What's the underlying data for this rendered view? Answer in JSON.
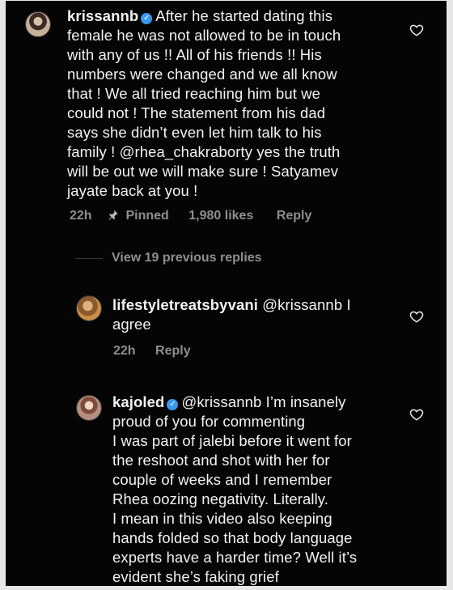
{
  "comments": [
    {
      "username": "krissannb",
      "text": "After he started dating this female he was not allowed to be in touch with any of us !! All of his friends !! His numbers were changed and we all know that ! We all tried reaching him but we could not ! The statement from his dad says she didn’t even let him talk to his family ! @rhea_chakraborty yes the truth will be out we will make sure ! Satyamev jayate back at you !",
      "lines": [
        "After he started dating this",
        "female he was not allowed to be in touch",
        "with any of us !! All of his friends !! His",
        "numbers were changed and we all know",
        "that ! We all tried reaching him but we",
        "could not ! The statement from his dad",
        "says she didn’t even let him talk to his",
        "family ! @rhea_chakraborty yes the truth",
        "will be out we will make sure ! Satyamev",
        "jayate back at you !"
      ],
      "time": "22h",
      "pinned": "Pinned",
      "likes": "1,980 likes",
      "reply": "Reply"
    },
    {
      "username": "lifestyletreatsbyvani",
      "lines": [
        "@krissannb I",
        "agree"
      ],
      "time": "22h",
      "reply": "Reply"
    },
    {
      "username": "kajoled",
      "lines": [
        "@krissannb I’m insanely",
        "proud of you for commenting",
        "I was part of jalebi before it went for",
        "the reshoot and shot with her for",
        "couple of weeks and I remember",
        "Rhea oozing negativity. Literally.",
        "I mean in this video also keeping",
        "hands folded so that body language",
        "experts have a harder time? Well it’s",
        "evident she’s faking grief"
      ]
    }
  ],
  "view_replies": "View 19 previous replies",
  "icons": {
    "verified": "verified-badge-icon",
    "pin": "pin-icon",
    "heart": "heart-icon"
  },
  "colors": {
    "background": "#050505",
    "text": "#f2f2f2",
    "muted": "#8e8e8e",
    "verified": "#3897f0"
  }
}
